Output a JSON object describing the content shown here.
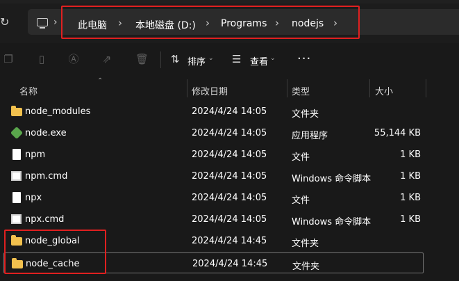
{
  "breadcrumb": {
    "items": [
      "此电脑",
      "本地磁盘 (D:)",
      "Programs",
      "nodejs"
    ]
  },
  "toolbar": {
    "sort_label": "排序",
    "view_label": "查看",
    "more_label": "···"
  },
  "columns": {
    "name": "名称",
    "date": "修改日期",
    "type": "类型",
    "size": "大小"
  },
  "files": [
    {
      "name": "node_modules",
      "date": "2024/4/24 14:05",
      "type": "文件夹",
      "size": "",
      "icon": "folder-icon"
    },
    {
      "name": "node.exe",
      "date": "2024/4/24 14:05",
      "type": "应用程序",
      "size": "55,144 KB",
      "icon": "node-exe-icon"
    },
    {
      "name": "npm",
      "date": "2024/4/24 14:05",
      "type": "文件",
      "size": "1 KB",
      "icon": "file-icon"
    },
    {
      "name": "npm.cmd",
      "date": "2024/4/24 14:05",
      "type": "Windows 命令脚本",
      "size": "1 KB",
      "icon": "cmd-file-icon"
    },
    {
      "name": "npx",
      "date": "2024/4/24 14:05",
      "type": "文件",
      "size": "1 KB",
      "icon": "file-icon"
    },
    {
      "name": "npx.cmd",
      "date": "2024/4/24 14:05",
      "type": "Windows 命令脚本",
      "size": "1 KB",
      "icon": "cmd-file-icon"
    },
    {
      "name": "node_global",
      "date": "2024/4/24 14:45",
      "type": "文件夹",
      "size": "",
      "icon": "folder-icon"
    },
    {
      "name": "node_cache",
      "date": "2024/4/24 14:45",
      "type": "文件夹",
      "size": "",
      "icon": "folder-icon"
    }
  ],
  "colors": {
    "background": "#191919",
    "folder": "#f2c14e",
    "highlight_box": "#e02020"
  }
}
